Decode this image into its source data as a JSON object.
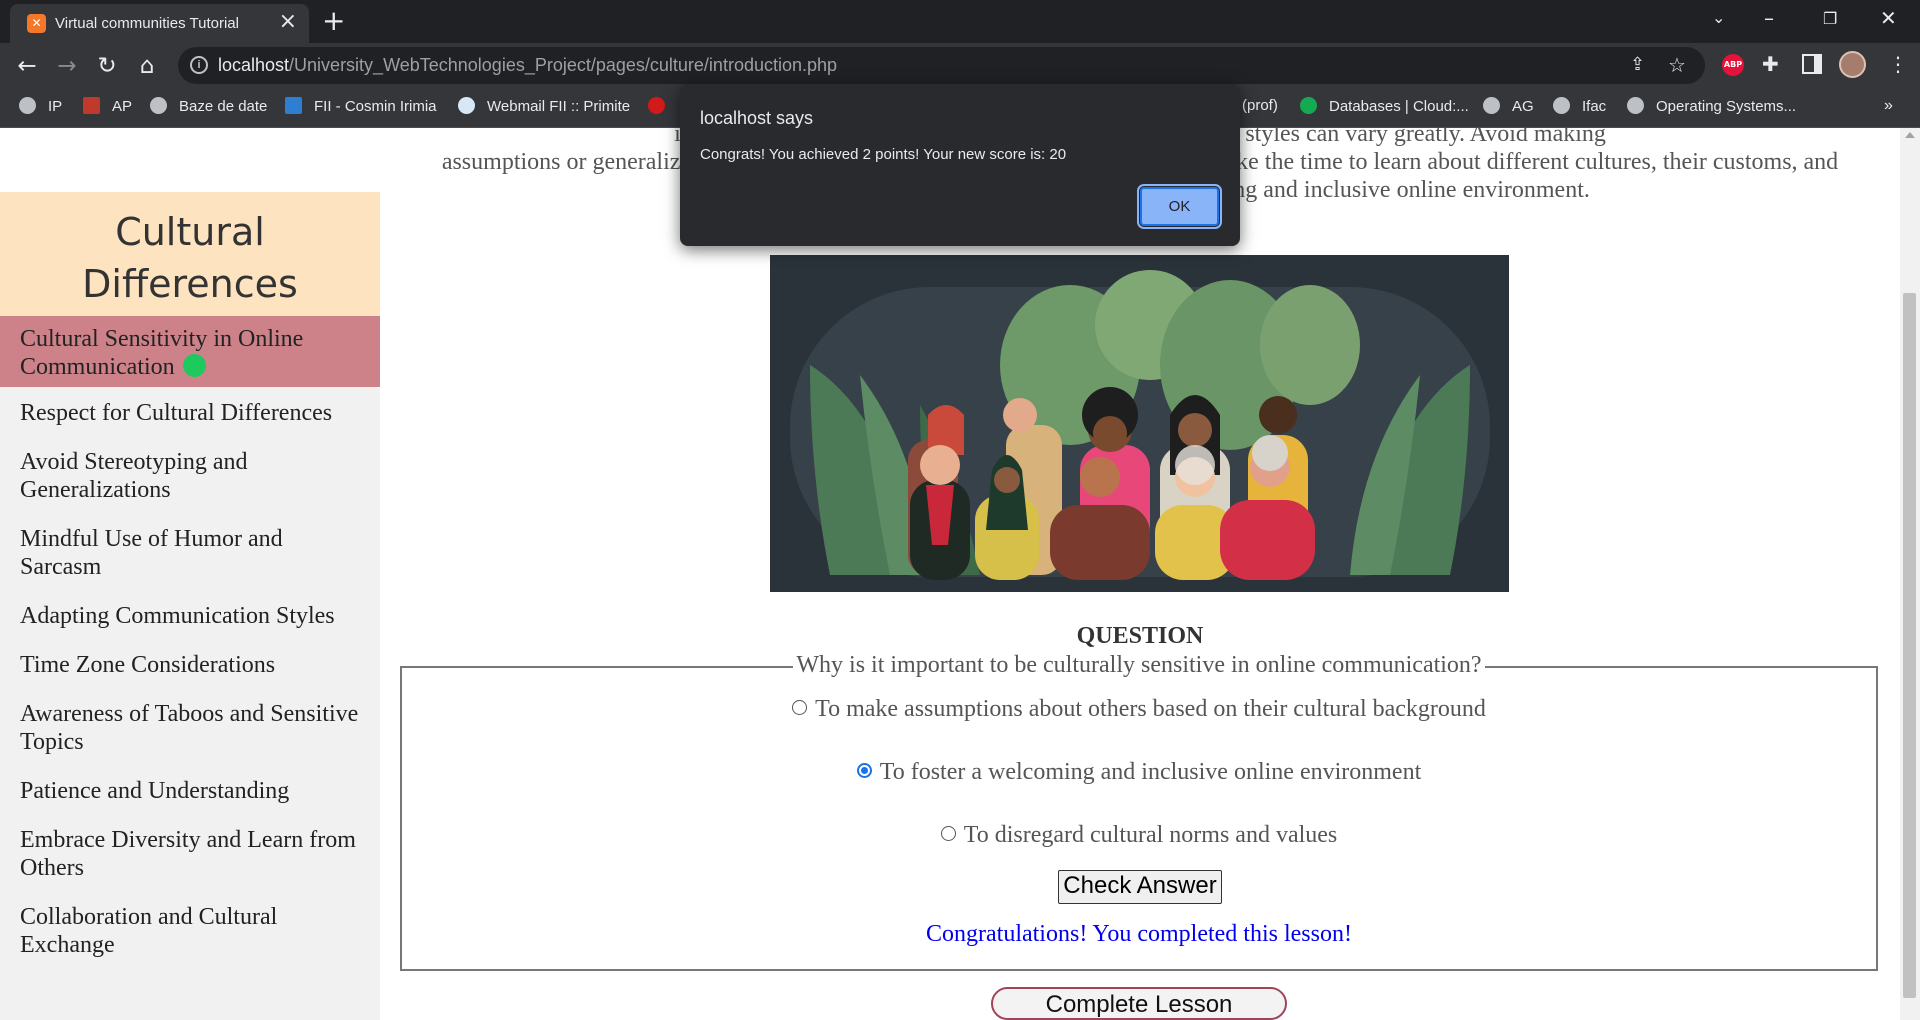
{
  "browser": {
    "tab_title": "Virtual communities Tutorial",
    "url_host": "localhost",
    "url_path": "/University_WebTechnologies_Project/pages/culture/introduction.php",
    "bookmarks": [
      "IP",
      "AP",
      "Baze de date",
      "FII - Cosmin Irimia",
      "Webmail FII :: Primite",
      "(prof)",
      "Databases | Cloud:...",
      "AG",
      "Ifac",
      "Operating Systems..."
    ],
    "ext_abp": "ABP"
  },
  "sidebar": {
    "title_line1": "Cultural",
    "title_line2": "Differences",
    "items": [
      {
        "label": "Cultural Sensitivity in Online Communication",
        "active": true
      },
      {
        "label": "Respect for Cultural Differences"
      },
      {
        "label": "Avoid Stereotyping and Generalizations"
      },
      {
        "label": "Mindful Use of Humor and Sarcasm"
      },
      {
        "label": "Adapting Communication Styles"
      },
      {
        "label": "Time Zone Considerations"
      },
      {
        "label": "Awareness of Taboos and Sensitive Topics"
      },
      {
        "label": "Patience and Understanding"
      },
      {
        "label": "Embrace Diversity and Learn from Others"
      },
      {
        "label": "Collaboration and Cultural Exchange"
      }
    ]
  },
  "main": {
    "intro_line1": "individuals from diverse backgrounds, and communication styles can vary greatly. Avoid making",
    "intro_line2": "assumptions or generalizations about others based on their cultural background. Take the time to learn about different cultures, their customs, and",
    "intro_line3": "appropriate forms of communication to foster a welcoming and inclusive online environment.",
    "question_heading": "QUESTION",
    "question_text": "Why is it important to be culturally sensitive in online communication?",
    "options": [
      {
        "label": "To make assumptions about others based on their cultural background",
        "checked": false
      },
      {
        "label": "To foster a welcoming and inclusive online environment",
        "checked": true
      },
      {
        "label": "To disregard cultural norms and values",
        "checked": false
      }
    ],
    "check_button": "Check Answer",
    "congrats_message": "Congratulations! You completed this lesson!",
    "complete_button": "Complete Lesson"
  },
  "dialog": {
    "title": "localhost says",
    "message": "Congrats! You achieved 2 points! Your new score is: 20",
    "ok_label": "OK"
  },
  "colors": {
    "sidebar_header_bg": "#fde3bf",
    "active_item_bg": "#cd828a",
    "completed_dot": "#1ec95d",
    "congrats_text": "#0000ee"
  }
}
